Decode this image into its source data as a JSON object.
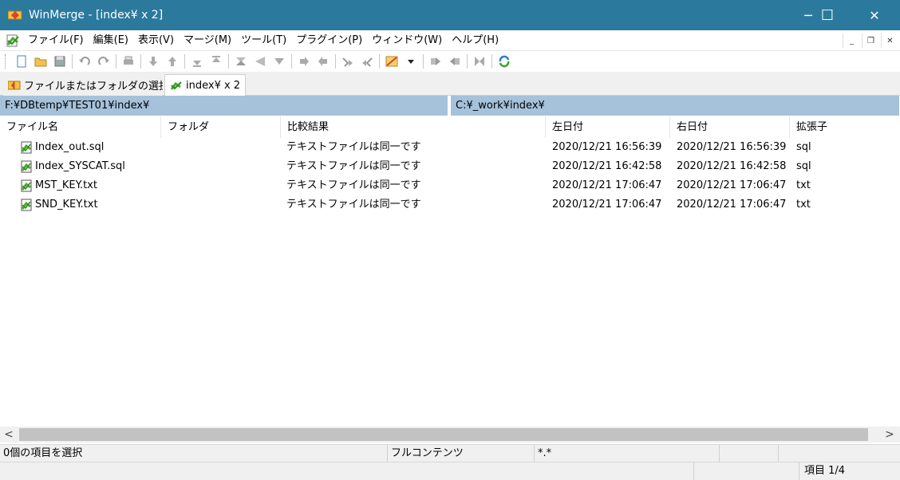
{
  "window": {
    "title": "WinMerge - [index¥ x 2]",
    "minimize": "─",
    "maximize": "☐",
    "close": "✕"
  },
  "menu": {
    "items": [
      "ファイル(F)",
      "編集(E)",
      "表示(V)",
      "マージ(M)",
      "ツール(T)",
      "プラグイン(P)",
      "ウィンドウ(W)",
      "ヘルプ(H)"
    ]
  },
  "mdi": {
    "minimize": "_",
    "restore": "❐",
    "close": "✕"
  },
  "tabs": [
    {
      "label": "ファイルまたはフォルダの選択..."
    },
    {
      "label": "index¥ x 2"
    }
  ],
  "paths": {
    "left": "F:¥DBtemp¥TEST01¥index¥",
    "right": "C:¥_work¥index¥"
  },
  "columns": [
    "ファイル名",
    "フォルダ",
    "比較結果",
    "左日付",
    "右日付",
    "拡張子"
  ],
  "rows": [
    {
      "name": "Index_out.sql",
      "folder": "",
      "result": "テキストファイルは同一です",
      "left_date": "2020/12/21 16:56:39",
      "right_date": "2020/12/21 16:56:39",
      "ext": "sql"
    },
    {
      "name": "Index_SYSCAT.sql",
      "folder": "",
      "result": "テキストファイルは同一です",
      "left_date": "2020/12/21 16:42:58",
      "right_date": "2020/12/21 16:42:58",
      "ext": "sql"
    },
    {
      "name": "MST_KEY.txt",
      "folder": "",
      "result": "テキストファイルは同一です",
      "left_date": "2020/12/21 17:06:47",
      "right_date": "2020/12/21 17:06:47",
      "ext": "txt"
    },
    {
      "name": "SND_KEY.txt",
      "folder": "",
      "result": "テキストファイルは同一です",
      "left_date": "2020/12/21 17:06:47",
      "right_date": "2020/12/21 17:06:47",
      "ext": "txt"
    }
  ],
  "scroll": {
    "left": "<",
    "right": ">"
  },
  "status": {
    "selection": "0個の項目を選択",
    "mode": "フルコンテンツ",
    "filter": "*.*",
    "item_count": "項目 1/4"
  },
  "colors": {
    "titlebar": "#2b7a9e",
    "pathbar": "#a6c2db"
  }
}
